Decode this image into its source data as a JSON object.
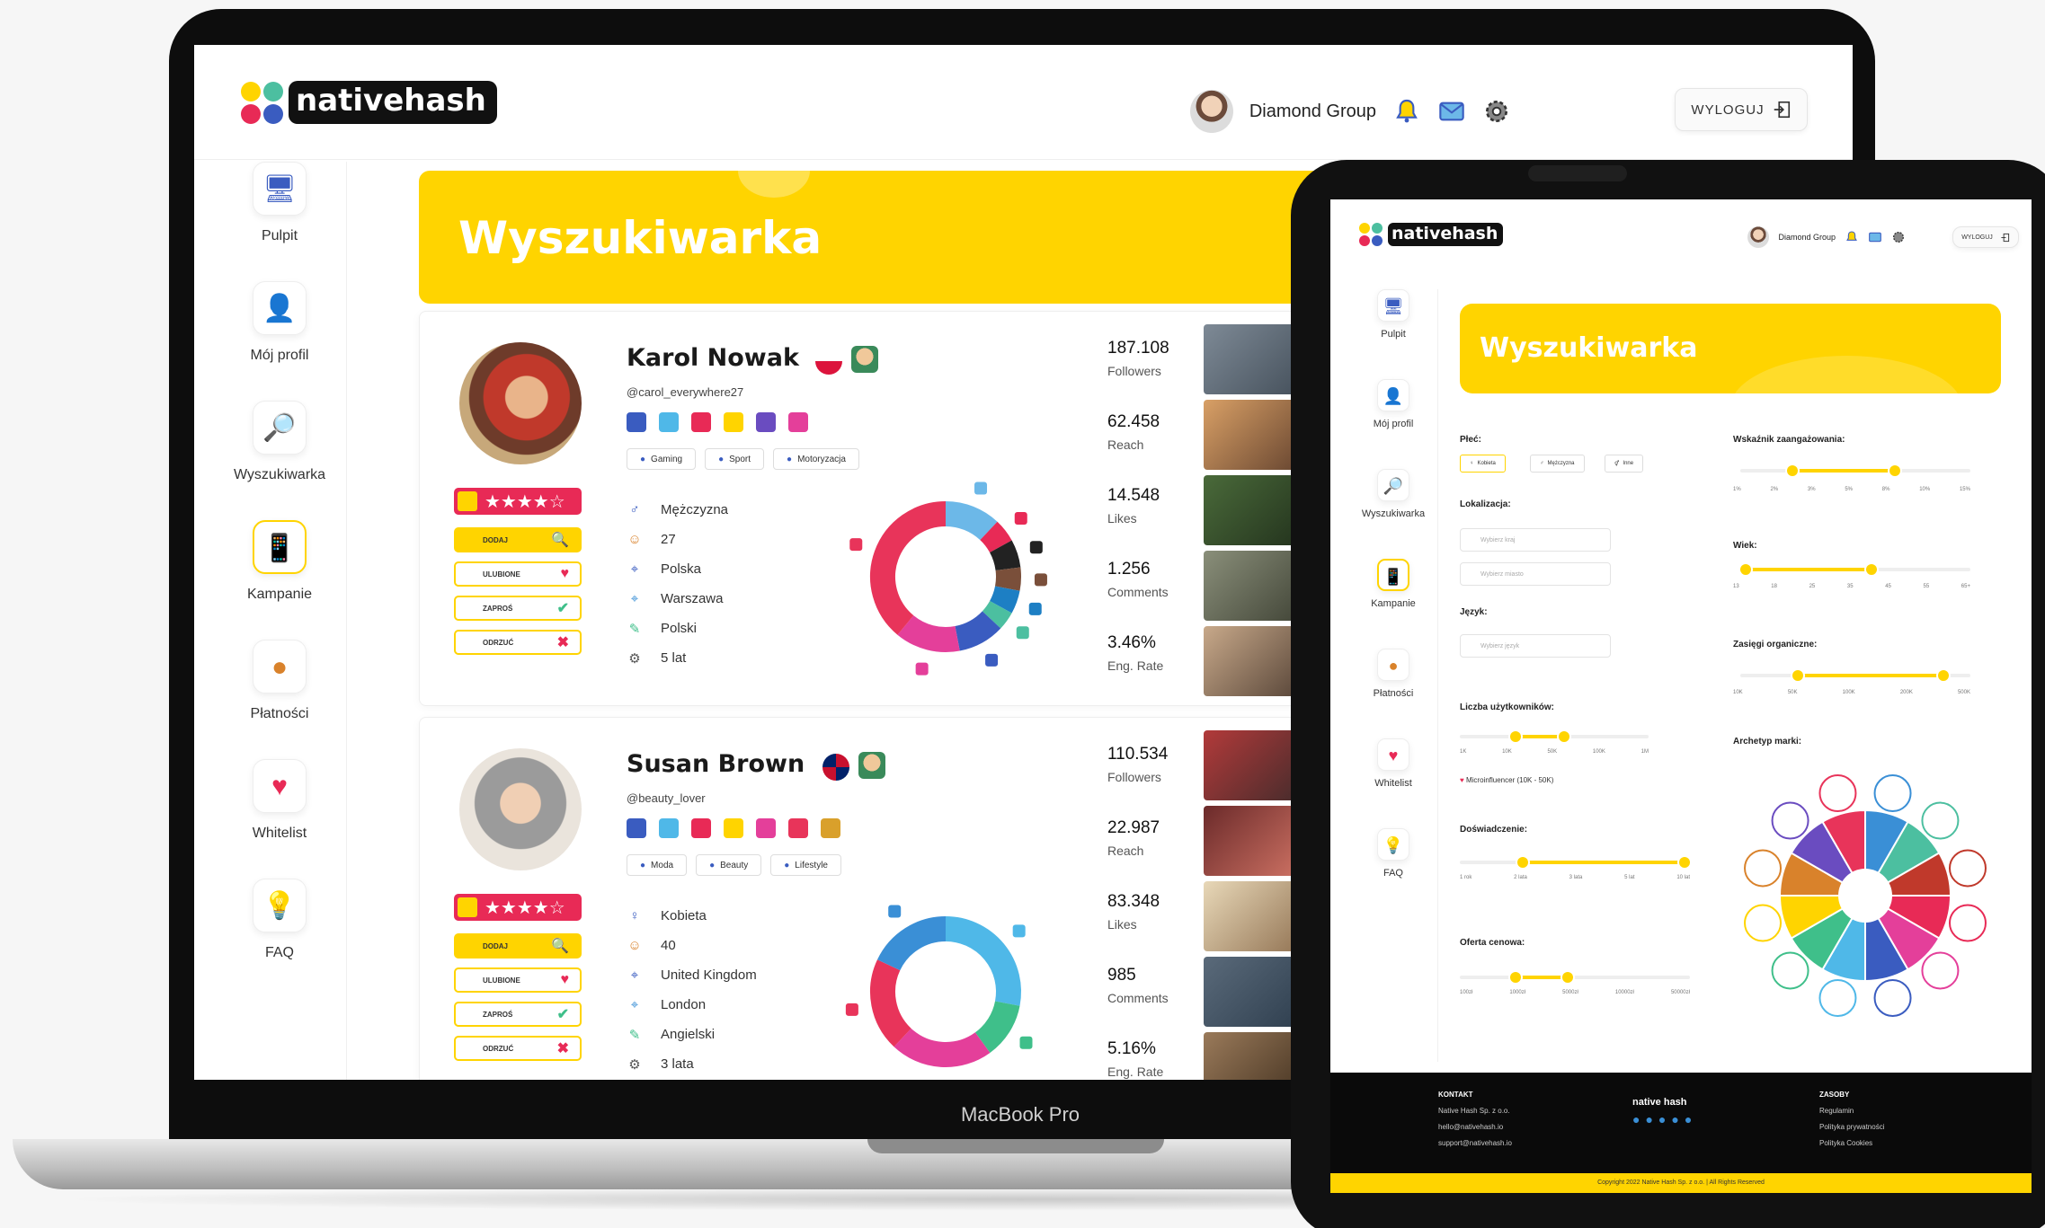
{
  "device_label": "MacBook Pro",
  "colors": {
    "brand_yellow": "#ffd400",
    "accent_red": "#e82a56",
    "dark": "#0d0d0d"
  },
  "brand": {
    "name": "nativehash"
  },
  "header": {
    "username": "Diamond Group",
    "logout_label": "WYLOGUJ",
    "icons": [
      "bell-icon",
      "mail-icon",
      "gear-icon",
      "logout-icon"
    ]
  },
  "sidebar": {
    "items": [
      {
        "label": "Pulpit",
        "icon": "desktop-icon"
      },
      {
        "label": "Mój profil",
        "icon": "profile-icon"
      },
      {
        "label": "Wyszukiwarka",
        "icon": "magnifier-icon"
      },
      {
        "label": "Kampanie",
        "icon": "campaign-icon"
      },
      {
        "label": "Płatności",
        "icon": "coin-icon"
      },
      {
        "label": "Whitelist",
        "icon": "heart-icon"
      },
      {
        "label": "FAQ",
        "icon": "lightbulb-icon"
      }
    ]
  },
  "page": {
    "title": "Wyszukiwarka"
  },
  "profiles": [
    {
      "name": "Karol Nowak",
      "handle": "@carol_everywhere27",
      "tags": [
        "Gaming",
        "Sport",
        "Motoryzacja"
      ],
      "info": [
        "Mężczyzna",
        "27",
        "Polska",
        "Warszawa",
        "Polski",
        "5 lat"
      ],
      "stats": [
        {
          "value": "187.108",
          "label": "Followers"
        },
        {
          "value": "62.458",
          "label": "Reach"
        },
        {
          "value": "14.548",
          "label": "Likes"
        },
        {
          "value": "1.256",
          "label": "Comments"
        },
        {
          "value": "3.46%",
          "label": "Eng. Rate"
        }
      ],
      "donut": [
        {
          "value": 12,
          "color": "#6cb8e8"
        },
        {
          "value": 5,
          "color": "#e82a56"
        },
        {
          "value": 6,
          "color": "#222222"
        },
        {
          "value": 5,
          "color": "#7a4f3a"
        },
        {
          "value": 5,
          "color": "#1d7fc4"
        },
        {
          "value": 4,
          "color": "#4cbfa0"
        },
        {
          "value": 10,
          "color": "#3a5cc0"
        },
        {
          "value": 14,
          "color": "#e43f9a"
        },
        {
          "value": 39,
          "color": "#e8345a"
        }
      ]
    },
    {
      "name": "Susan Brown",
      "handle": "@beauty_lover",
      "tags": [
        "Moda",
        "Beauty",
        "Lifestyle"
      ],
      "info": [
        "Kobieta",
        "40",
        "United Kingdom",
        "London",
        "Angielski",
        "3 lata"
      ],
      "stats": [
        {
          "value": "110.534",
          "label": "Followers"
        },
        {
          "value": "22.987",
          "label": "Reach"
        },
        {
          "value": "83.348",
          "label": "Likes"
        },
        {
          "value": "985",
          "label": "Comments"
        },
        {
          "value": "5.16%",
          "label": "Eng. Rate"
        }
      ],
      "donut": [
        {
          "value": 28,
          "color": "#4fb8e8"
        },
        {
          "value": 12,
          "color": "#3fbf8a"
        },
        {
          "value": 22,
          "color": "#e43f9a"
        },
        {
          "value": 20,
          "color": "#e8345a"
        },
        {
          "value": 18,
          "color": "#3a8fd6"
        }
      ]
    }
  ],
  "card_actions": [
    "DODAJ",
    "ULUBIONE",
    "ZAPROŚ",
    "ODRZUĆ"
  ],
  "filters": {
    "plec": "Płeć:",
    "plec_options": [
      "Kobieta",
      "Mężczyzna",
      "Inne"
    ],
    "lokalizacja": "Lokalizacja:",
    "lokalizacja_placeholders": [
      "Wybierz kraj",
      "Wybierz miasto"
    ],
    "jezyk": "Język:",
    "jezyk_placeholder": "Wybierz język",
    "liczba": "Liczba użytkowników:",
    "liczba_ticks": [
      "1K",
      "10K",
      "50K",
      "100K",
      "1M"
    ],
    "liczba_note": "Microinfluencer (10K - 50K)",
    "doswiadczenie": "Doświadczenie:",
    "doswiadczenie_ticks": [
      "1 rok",
      "2 lata",
      "3 lata",
      "5 lat",
      "10 lat"
    ],
    "oferta": "Oferta cenowa:",
    "oferta_ticks": [
      "100zł",
      "1000zł",
      "5000zł",
      "10000zł",
      "50000zł"
    ],
    "wskaznik": "Wskaźnik zaangażowania:",
    "wskaznik_ticks": [
      "1%",
      "2%",
      "3%",
      "5%",
      "8%",
      "10%",
      "15%"
    ],
    "wiek": "Wiek:",
    "wiek_ticks": [
      "13",
      "18",
      "25",
      "35",
      "45",
      "55",
      "65+"
    ],
    "zasiegi": "Zasięgi organiczne:",
    "zasiegi_ticks": [
      "10K",
      "50K",
      "100K",
      "200K",
      "500K"
    ],
    "archetyp": "Archetyp marki:"
  },
  "footer": {
    "kontakt_title": "KONTAKT",
    "kontakt_lines": [
      "Native Hash Sp. z o.o.",
      "hello@nativehash.io",
      "support@nativehash.io"
    ],
    "brand": "native hash",
    "zasoby_title": "ZASOBY",
    "zasoby_lines": [
      "Regulamin",
      "Polityka prywatności",
      "Polityka Cookies"
    ],
    "copyright": "Copyright 2022 Native Hash Sp. z o.o. | All Rights Reserved"
  }
}
